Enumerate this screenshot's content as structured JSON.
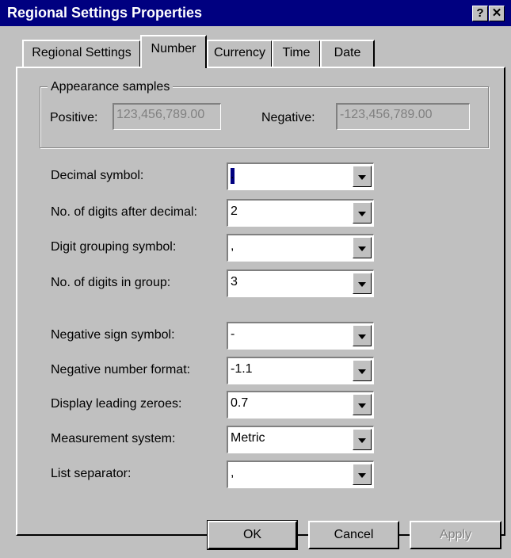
{
  "window": {
    "title": "Regional Settings Properties",
    "help_glyph": "?",
    "close_glyph": "✕"
  },
  "tabs": [
    "Regional Settings",
    "Number",
    "Currency",
    "Time",
    "Date"
  ],
  "active_tab": "Number",
  "appearance": {
    "title": "Appearance samples",
    "positive_label": "Positive:",
    "positive_value": "123,456,789.00",
    "negative_label": "Negative:",
    "negative_value": "-123,456,789.00"
  },
  "fields": [
    {
      "label": "Decimal symbol:",
      "value": "."
    },
    {
      "label": "No. of digits after decimal:",
      "value": "2"
    },
    {
      "label": "Digit grouping symbol:",
      "value": ","
    },
    {
      "label": "No. of digits in group:",
      "value": "3"
    },
    {
      "label": "Negative sign symbol:",
      "value": "-"
    },
    {
      "label": "Negative number format:",
      "value": "-1.1"
    },
    {
      "label": "Display leading zeroes:",
      "value": "0.7"
    },
    {
      "label": "Measurement system:",
      "value": "Metric"
    },
    {
      "label": "List separator:",
      "value": ","
    }
  ],
  "buttons": {
    "ok": "OK",
    "cancel": "Cancel",
    "apply": "Apply"
  }
}
